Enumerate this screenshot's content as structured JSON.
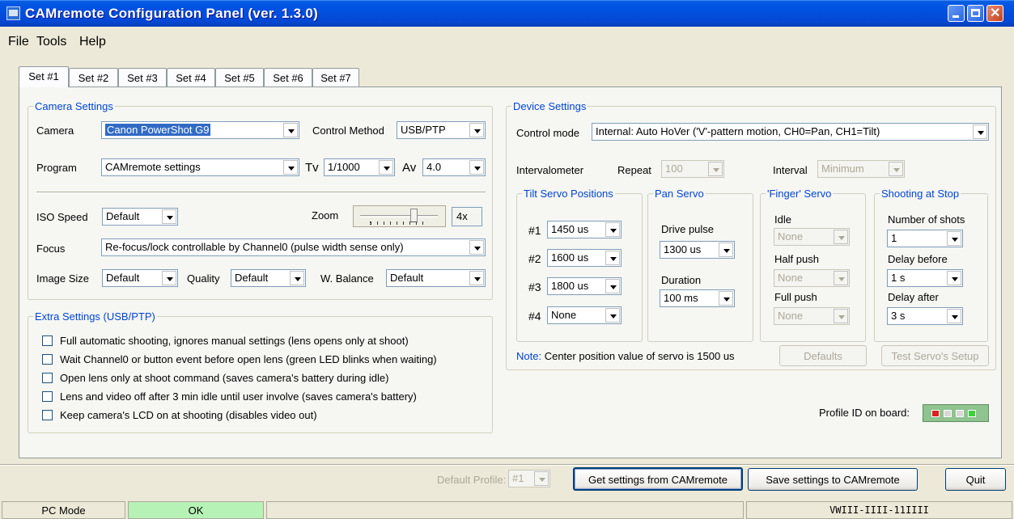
{
  "window": {
    "title": "CAMremote Configuration Panel (ver. 1.3.0)"
  },
  "menu": [
    "File",
    "Tools",
    "Help"
  ],
  "tabs": [
    "Set #1",
    "Set #2",
    "Set #3",
    "Set #4",
    "Set #5",
    "Set #6",
    "Set #7"
  ],
  "camera": {
    "legend": "Camera Settings",
    "camera_label": "Camera",
    "camera_value": "Canon PowerShot G9",
    "control_method_label": "Control Method",
    "control_method_value": "USB/PTP",
    "program_label": "Program",
    "program_value": "CAMremote settings",
    "tv_label": "Tv",
    "tv_value": "1/1000",
    "av_label": "Av",
    "av_value": "4.0",
    "iso_label": "ISO Speed",
    "iso_value": "Default",
    "zoom_label": "Zoom",
    "zoom_value": "4x",
    "focus_label": "Focus",
    "focus_value": "Re-focus/lock controllable by Channel0 (pulse width sense only)",
    "image_size_label": "Image Size",
    "image_size_value": "Default",
    "quality_label": "Quality",
    "quality_value": "Default",
    "wb_label": "W. Balance",
    "wb_value": "Default"
  },
  "extra": {
    "legend": "Extra Settings (USB/PTP)",
    "options": [
      "Full automatic shooting, ignores manual settings (lens opens only at shoot)",
      "Wait Channel0 or button event before open lens (green LED blinks when waiting)",
      "Open lens only at shoot command (saves camera's battery during idle)",
      "Lens and video off after 3 min idle until user involve (saves camera's battery)",
      "Keep camera's LCD on at shooting (disables video out)"
    ]
  },
  "device": {
    "legend": "Device Settings",
    "control_mode_label": "Control mode",
    "control_mode_value": "Internal: Auto HoVer ('V'-pattern motion, CH0=Pan, CH1=Tilt)",
    "intervalometer_label": "Intervalometer",
    "repeat_label": "Repeat",
    "repeat_value": "100",
    "interval_label": "Interval",
    "interval_value": "Minimum",
    "tilt": {
      "legend": "Tilt Servo Positions",
      "rows": [
        {
          "label": "#1",
          "value": "1450 us"
        },
        {
          "label": "#2",
          "value": "1600 us"
        },
        {
          "label": "#3",
          "value": "1800 us"
        },
        {
          "label": "#4",
          "value": "None"
        }
      ]
    },
    "pan": {
      "legend": "Pan Servo",
      "drive_label": "Drive pulse",
      "drive_value": "1300 us",
      "duration_label": "Duration",
      "duration_value": "100 ms"
    },
    "finger": {
      "legend": "'Finger' Servo",
      "idle_label": "Idle",
      "idle_value": "None",
      "half_label": "Half push",
      "half_value": "None",
      "full_label": "Full push",
      "full_value": "None"
    },
    "stop": {
      "legend": "Shooting at Stop",
      "shots_label": "Number of shots",
      "shots_value": "1",
      "before_label": "Delay before",
      "before_value": "1 s",
      "after_label": "Delay after",
      "after_value": "3 s"
    },
    "note_prefix": "Note:",
    "note_text": "Center position value of servo is 1500 us",
    "defaults_button": "Defaults",
    "test_button": "Test Servo's Setup"
  },
  "profile_id_label": "Profile ID on board:",
  "bottom": {
    "default_profile_label": "Default Profile:",
    "default_profile_value": "#1",
    "get_button": "Get settings from CAMremote",
    "save_button": "Save settings to CAMremote",
    "quit_button": "Quit"
  },
  "status": {
    "mode": "PC Mode",
    "state": "OK",
    "version": "VWIII-IIII-11IIII"
  }
}
